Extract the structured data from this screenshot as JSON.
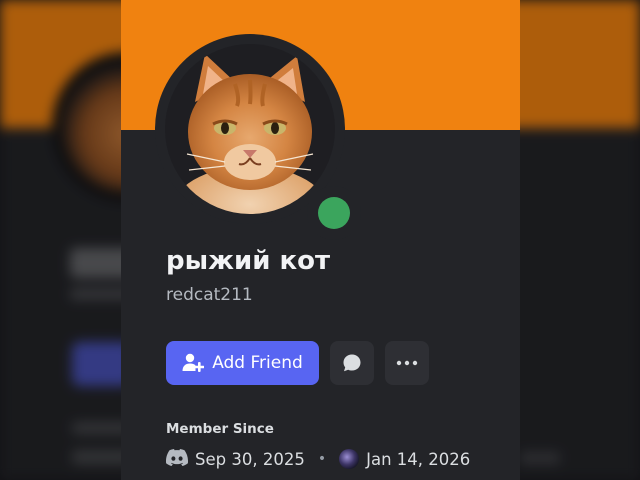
{
  "profile": {
    "display_name": "рыжий кот",
    "username": "redcat211",
    "status": "online",
    "banner_color": "#f08210",
    "avatar_icon": "orange-cat-avatar"
  },
  "actions": {
    "add_friend_label": "Add Friend",
    "add_friend_icon": "add-friend-icon",
    "message_icon": "chat-bubble-icon",
    "more_icon": "more-options-icon"
  },
  "member_since": {
    "label": "Member Since",
    "discord_icon": "discord-logo-icon",
    "discord_date": "Sep 30, 2025",
    "separator": "•",
    "server_icon": "server-icon",
    "server_date": "Jan 14, 2026"
  },
  "colors": {
    "accent": "#5865f2",
    "status_online": "#3ba55d",
    "card_bg": "#232428"
  }
}
